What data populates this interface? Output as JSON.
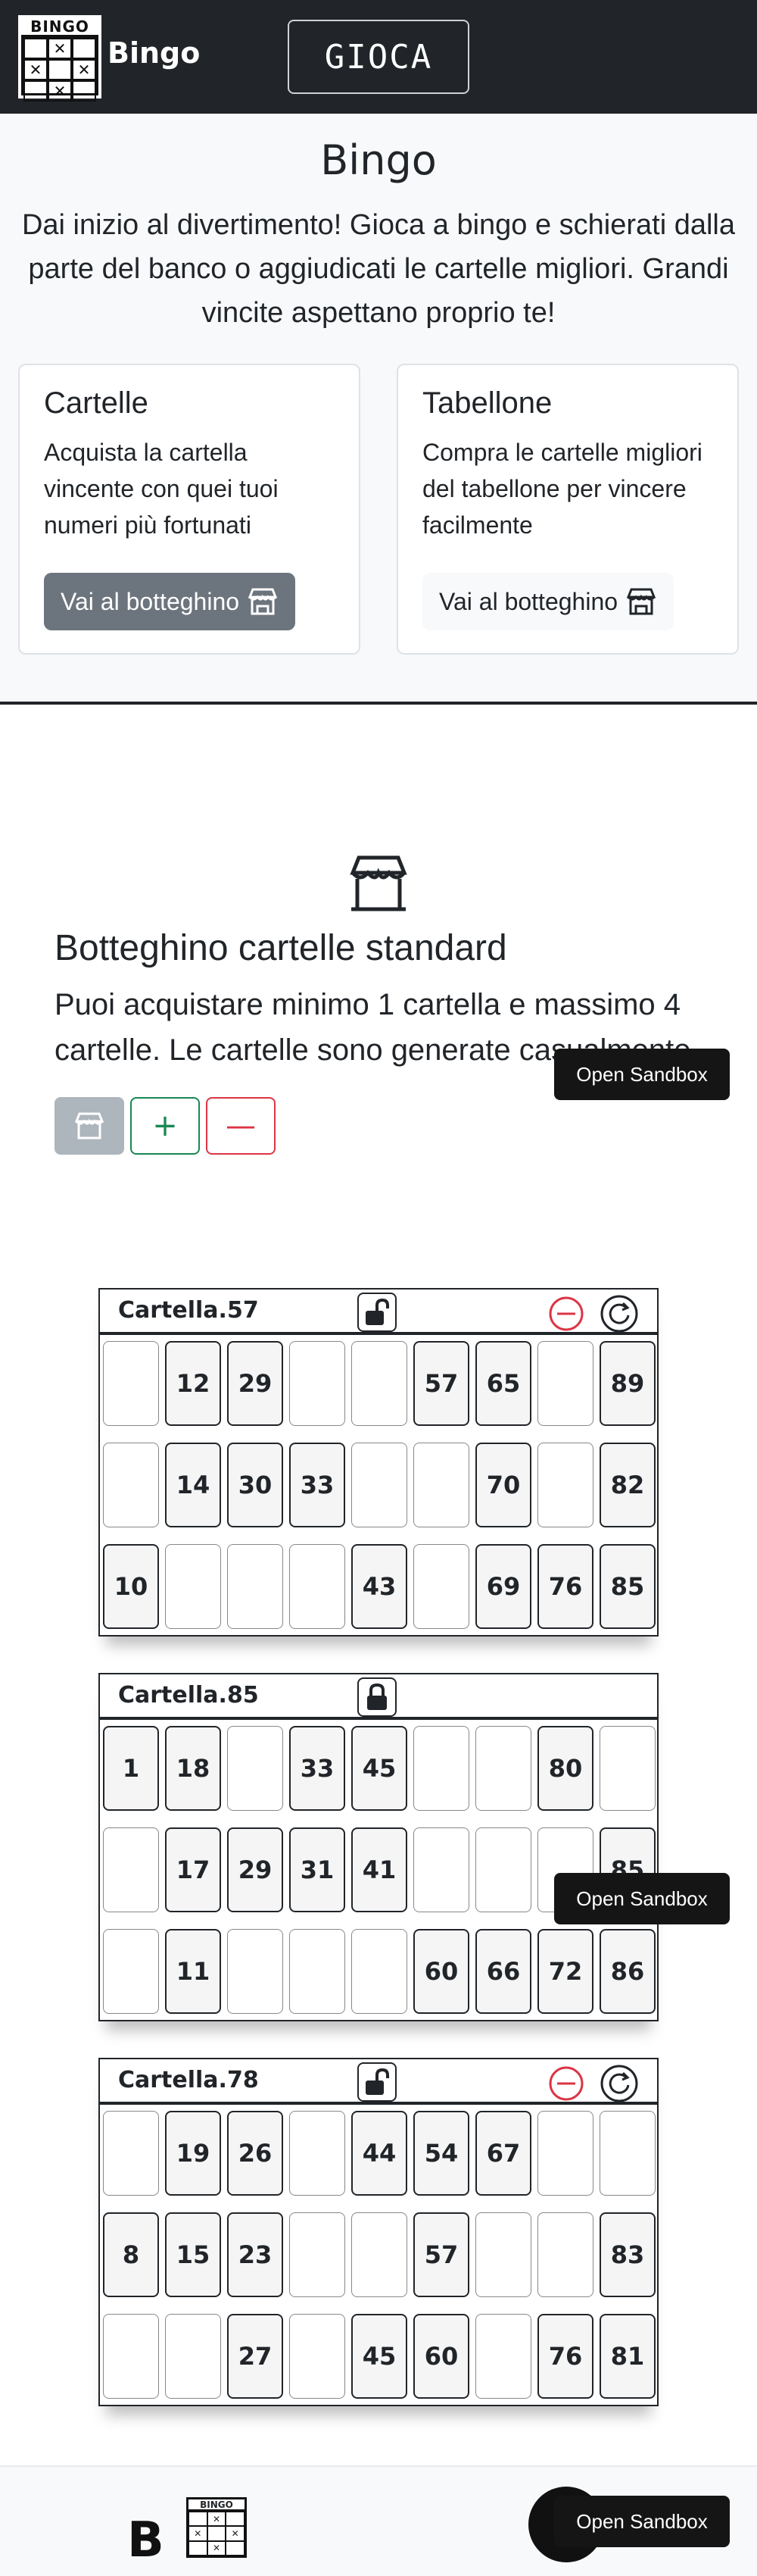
{
  "header": {
    "logo_text": "BINGO",
    "brand": "Bingo",
    "play_label": "GIOCA",
    "logo_icon": "bingo-grid-icon"
  },
  "hero": {
    "title": "Bingo",
    "lead": "Dai inizio al divertimento! Gioca a bingo e schierati dalla parte del banco o aggiudicati le cartelle migliori. Grandi vincite aspettano proprio te!",
    "cards": [
      {
        "title": "Cartelle",
        "text": "Acquista la cartella vincente con quei tuoi numeri più fortunati",
        "button": "Vai al botteghino",
        "icon": "shop-icon"
      },
      {
        "title": "Tabellone",
        "text": "Compra le cartelle migliori del tabellone per vincere facilmente",
        "button": "Vai al botteghino",
        "icon": "shop-icon"
      }
    ]
  },
  "shop": {
    "icon": "shop-icon",
    "title": "Botteghino cartelle standard",
    "text": "Puoi acquistare minimo 1 cartella e massimo 4 cartelle. Le cartelle sono generate casualmente",
    "buttons": {
      "shop": "shop-icon",
      "plus": "+",
      "minus": "—"
    }
  },
  "sandbox_label": "Open Sandbox",
  "tickets": [
    {
      "name": "Cartella.57",
      "locked": false,
      "rows": [
        [
          "",
          "12",
          "29",
          "",
          "",
          "57",
          "65",
          "",
          "89"
        ],
        [
          "",
          "14",
          "30",
          "33",
          "",
          "",
          "70",
          "",
          "82"
        ],
        [
          "10",
          "",
          "",
          "",
          "43",
          "",
          "69",
          "76",
          "85"
        ]
      ]
    },
    {
      "name": "Cartella.85",
      "locked": true,
      "rows": [
        [
          "1",
          "18",
          "",
          "33",
          "45",
          "",
          "",
          "80",
          ""
        ],
        [
          "",
          "17",
          "29",
          "31",
          "41",
          "",
          "",
          "",
          "85"
        ],
        [
          "",
          "11",
          "",
          "",
          "",
          "60",
          "66",
          "72",
          "86"
        ]
      ]
    },
    {
      "name": "Cartella.78",
      "locked": false,
      "rows": [
        [
          "",
          "19",
          "26",
          "",
          "44",
          "54",
          "67",
          "",
          ""
        ],
        [
          "8",
          "15",
          "23",
          "",
          "",
          "57",
          "",
          "",
          "83"
        ],
        [
          "",
          "",
          "27",
          "",
          "45",
          "60",
          "",
          "76",
          "81"
        ]
      ]
    }
  ],
  "footer": {
    "letter": "B",
    "logo_text": "BINGO"
  },
  "colors": {
    "dark": "#212529",
    "green": "#198754",
    "red": "#dc3545",
    "gray": "#6c757d"
  }
}
